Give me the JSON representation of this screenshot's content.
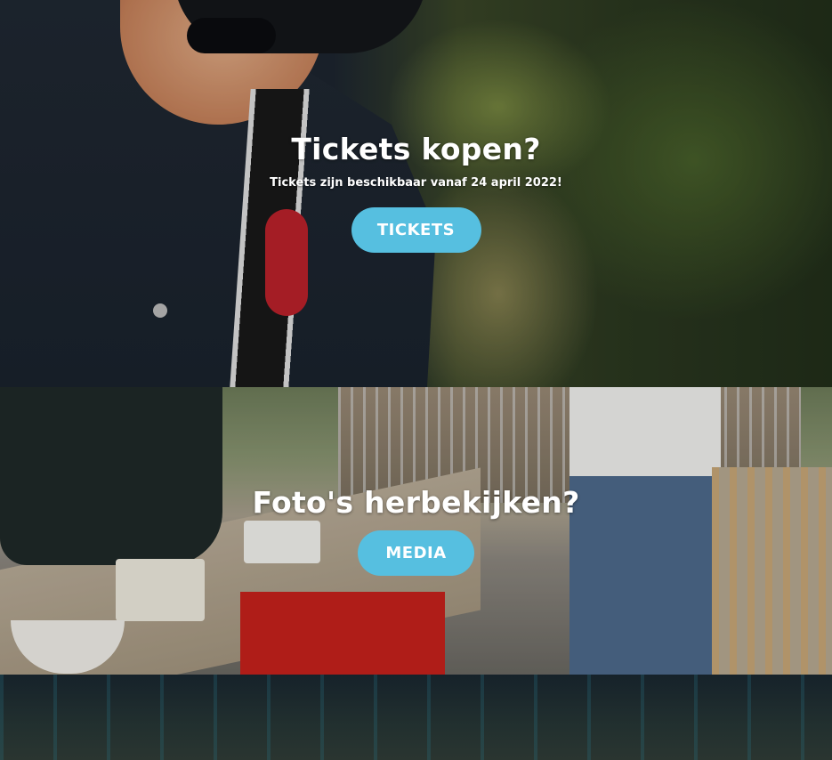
{
  "tickets_section": {
    "title": "Tickets kopen?",
    "subtitle": "Tickets zijn beschikbaar vanaf 24 april 2022!",
    "button_label": "TICKETS",
    "button_color": "#56bfe0"
  },
  "media_section": {
    "title": "Foto's herbekijken?",
    "button_label": "MEDIA",
    "button_color": "#56bfe0"
  }
}
